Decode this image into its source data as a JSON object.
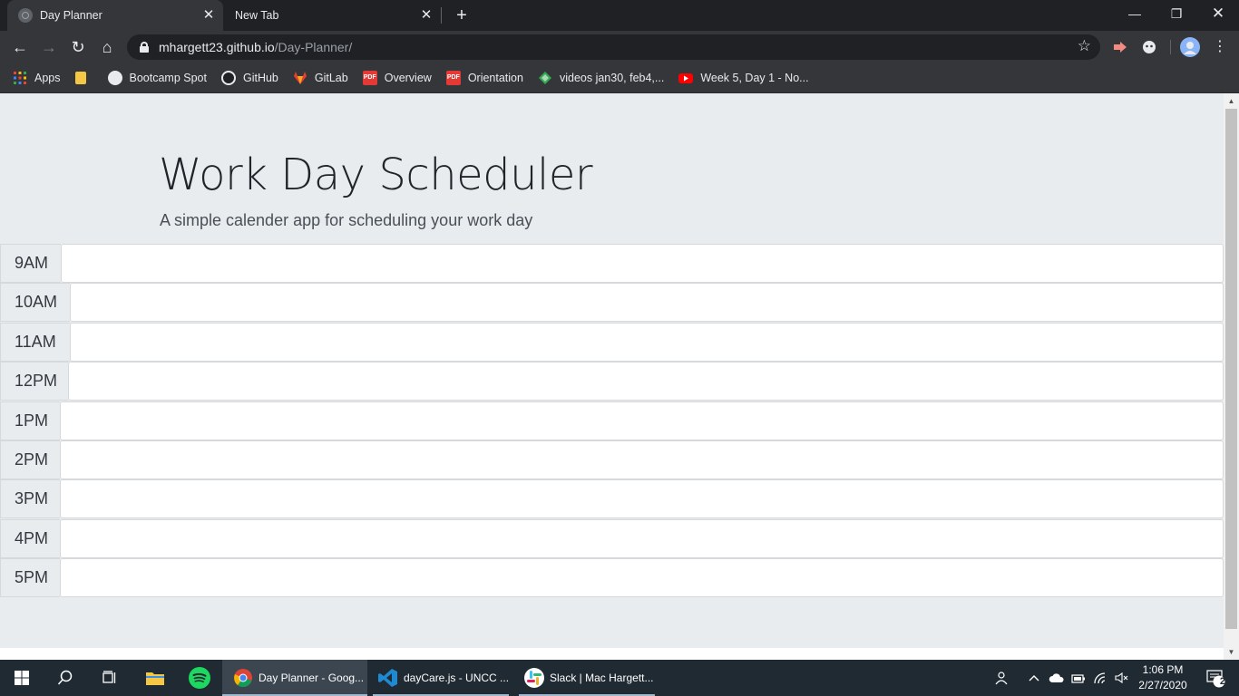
{
  "browser": {
    "tabs": [
      {
        "title": "Day Planner",
        "active": true
      },
      {
        "title": "New Tab",
        "active": false
      }
    ],
    "address": {
      "host": "mhargett23.github.io",
      "path": "/Day-Planner/"
    },
    "bookmarks": [
      {
        "label": "Apps",
        "icon": "apps-grid-icon",
        "color": "#ea4335"
      },
      {
        "label": "",
        "icon": "folder-icon",
        "color": "#f6c744"
      },
      {
        "label": "Bootcamp Spot",
        "icon": "bootcamp-spot-icon",
        "color": "#e8eaed"
      },
      {
        "label": "GitHub",
        "icon": "github-icon",
        "color": "#e8eaed"
      },
      {
        "label": "GitLab",
        "icon": "gitlab-icon",
        "color": "#e2432a"
      },
      {
        "label": "Overview",
        "icon": "pdf-icon",
        "color": "#e53935"
      },
      {
        "label": "Orientation",
        "icon": "pdf-icon",
        "color": "#e53935"
      },
      {
        "label": "videos jan30, feb4,...",
        "icon": "drive-icon",
        "color": "#34a853"
      },
      {
        "label": "Week 5, Day 1 - No...",
        "icon": "youtube-icon",
        "color": "#ff0000"
      }
    ]
  },
  "page": {
    "title": "Work Day Scheduler",
    "subtitle": "A simple calender app for scheduling your work day",
    "hours": [
      "9AM",
      "10AM",
      "11AM",
      "12PM",
      "1PM",
      "2PM",
      "3PM",
      "4PM",
      "5PM"
    ]
  },
  "taskbar": {
    "apps": [
      {
        "label": "Day Planner - Goog...",
        "icon": "chrome-icon",
        "active": true
      },
      {
        "label": "dayCare.js - UNCC ...",
        "icon": "vscode-icon",
        "active": false
      },
      {
        "label": "Slack | Mac Hargett...",
        "icon": "slack-icon",
        "active": false
      }
    ],
    "clock": {
      "time": "1:06 PM",
      "date": "2/27/2020"
    },
    "notifications": "20"
  },
  "colors": {
    "jumbotron": "#e9ecef",
    "chrome_dark": "#202124",
    "chrome_toolbar": "#35363a",
    "taskbar": "#202a33"
  }
}
